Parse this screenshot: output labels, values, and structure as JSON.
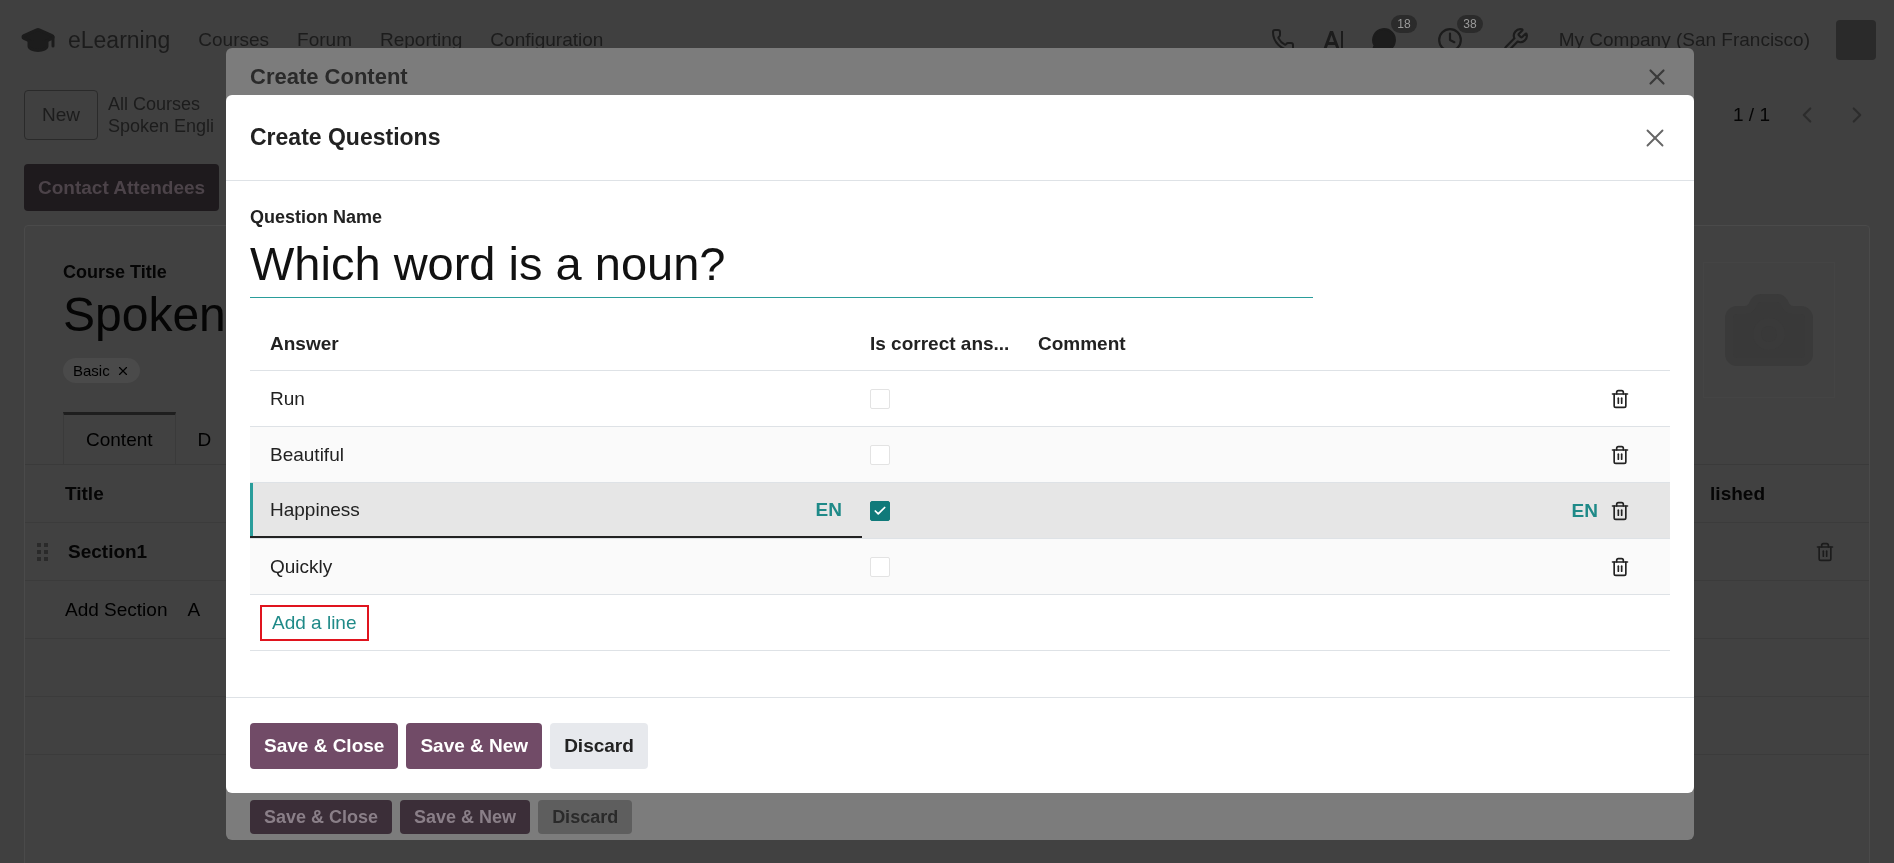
{
  "navbar": {
    "app_name": "eLearning",
    "menu": [
      "Courses",
      "Forum",
      "Reporting",
      "Configuration"
    ],
    "messages_badge": "18",
    "activities_badge": "38",
    "company": "My Company (San Francisco)"
  },
  "control_panel": {
    "new_button": "New",
    "breadcrumbs": [
      "All Courses",
      "Spoken Engli"
    ],
    "pager": "1 / 1"
  },
  "actions": [
    "Contact Attendees"
  ],
  "course": {
    "title_label": "Course Title",
    "title": "Spoken",
    "tags": [
      "Basic"
    ],
    "tabs": [
      {
        "label": "Content",
        "selected": true
      },
      {
        "label": "D",
        "selected": false
      }
    ],
    "columns": [
      "Title",
      "lished"
    ],
    "rows": [
      {
        "title": "Section1"
      }
    ],
    "add_links": [
      "Add Section",
      "A"
    ]
  },
  "back_dialog": {
    "title": "Create Content",
    "buttons": [
      "Save & Close",
      "Save & New",
      "Discard"
    ]
  },
  "dialog": {
    "title": "Create Questions",
    "question_label": "Question Name",
    "question": "Which word is a noun?",
    "columns": [
      "Answer",
      "Is correct ans...",
      "Comment"
    ],
    "answers": [
      {
        "text": "Run",
        "correct": false,
        "selected": false
      },
      {
        "text": "Beautiful",
        "correct": false,
        "selected": false
      },
      {
        "text": "Happiness",
        "correct": true,
        "selected": true,
        "lang_badges": [
          "EN",
          "EN"
        ]
      },
      {
        "text": "Quickly",
        "correct": false,
        "selected": false
      }
    ],
    "add_line": {
      "label": "Add a line",
      "highlighted": true
    },
    "buttons": [
      {
        "label": "Save & Close",
        "kind": "primary"
      },
      {
        "label": "Save & New",
        "kind": "primary"
      },
      {
        "label": "Discard",
        "kind": "secondary"
      }
    ]
  }
}
